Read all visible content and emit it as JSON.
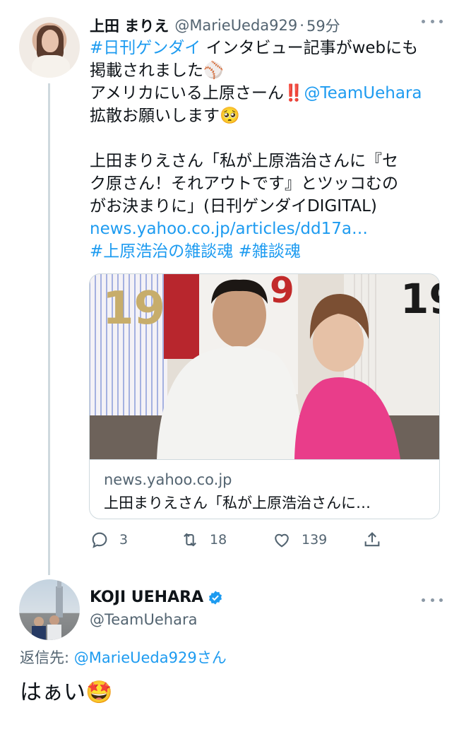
{
  "tweet": {
    "author_name": "上田 まりえ",
    "author_handle": "@MarieUeda929",
    "separator": "·",
    "time": "59分",
    "lines": {
      "l1_hashtag": "#日刊ゲンダイ",
      "l1_text": " インタビュー記事がwebにも",
      "l2_text": "掲載されました⚾",
      "l3_text": "アメリカにいる上原さーん",
      "l3_emoji": "‼️",
      "l3_mention": "@TeamUehara",
      "l4_text": "拡散お願いします🥺",
      "l6_text": "上田まりえさん「私が上原浩治さんに『セ",
      "l7_text": "ク原さん！それアウトです』とツッコむの",
      "l8_text": "がお決まりに」(日刊ゲンダイDIGITAL)",
      "l9_link": "news.yahoo.co.jp/articles/dd17a…",
      "l10_hashtags": "#上原浩治の雑談魂 #雑談魂"
    },
    "card": {
      "domain": "news.yahoo.co.jp",
      "title": "上田まりえさん「私が上原浩治さんに…"
    },
    "actions": {
      "replies": "3",
      "retweets": "18",
      "likes": "139"
    }
  },
  "reply": {
    "author_name": "KOJI UEHARA",
    "author_handle": "@TeamUehara",
    "reply_to_prefix": "返信先: ",
    "reply_to_handle": "@MarieUeda929さん",
    "text": "はぁい🤩"
  },
  "colors": {
    "link": "#1d9bf0",
    "secondary_text": "#536471",
    "border": "#cfd9de",
    "verified": "#1d9bf0"
  },
  "icons": [
    "more-icon",
    "reply-icon",
    "retweet-icon",
    "like-icon",
    "share-icon",
    "verified-badge-icon"
  ]
}
